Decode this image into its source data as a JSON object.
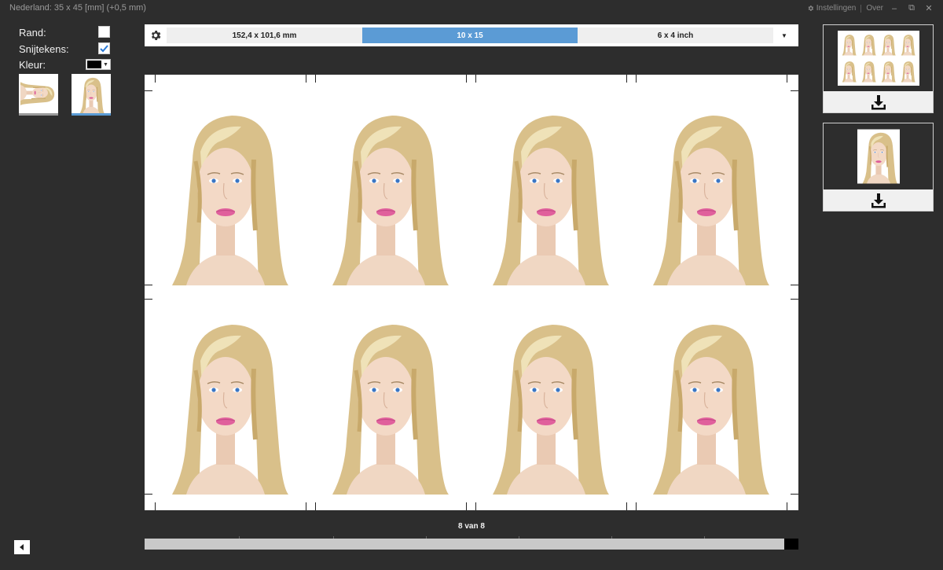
{
  "window": {
    "title": "Nederland: 35 x 45 [mm] (+0,5 mm)",
    "settings_label": "Instellingen",
    "about_label": "Over"
  },
  "options": {
    "border_label": "Rand:",
    "border_checked": false,
    "cutmarks_label": "Snijtekens:",
    "cutmarks_checked": true,
    "color_label": "Kleur:",
    "color_value": "#000000"
  },
  "sizes": {
    "items": [
      "152,4 x 101,6 mm",
      "10 x 15",
      "6 x 4 inch"
    ],
    "selected": "10 x 15"
  },
  "sheet": {
    "rows": 2,
    "columns": 4
  },
  "pager": {
    "label": "8 van 8"
  },
  "colors": {
    "accent": "#5b9bd5",
    "background": "#2d2d2d"
  }
}
